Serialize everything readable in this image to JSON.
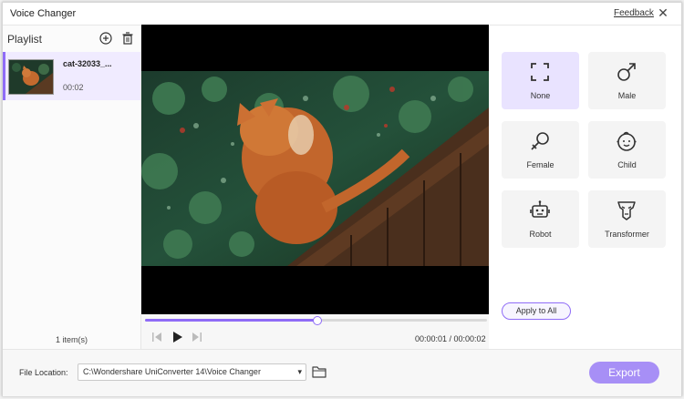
{
  "window": {
    "title": "Voice Changer",
    "feedback_label": "Feedback",
    "close_icon": "close-icon"
  },
  "playlist": {
    "title": "Playlist",
    "add_icon": "add-circle-icon",
    "delete_icon": "trash-icon",
    "items": [
      {
        "name": "cat-32033_...",
        "duration": "00:02",
        "selected": true
      }
    ],
    "count_text": "1 item(s)"
  },
  "player": {
    "progress": 0.5,
    "current_time": "00:00:01",
    "total_time": "00:00:02",
    "time_display": "00:00:01 / 00:00:02",
    "controls": [
      "previous-icon",
      "play-icon",
      "next-icon"
    ]
  },
  "effects": {
    "items": [
      {
        "label": "None",
        "icon": "none-frame-icon",
        "selected": true
      },
      {
        "label": "Male",
        "icon": "male-icon",
        "selected": false
      },
      {
        "label": "Female",
        "icon": "female-icon",
        "selected": false
      },
      {
        "label": "Child",
        "icon": "child-icon",
        "selected": false
      },
      {
        "label": "Robot",
        "icon": "robot-icon",
        "selected": false
      },
      {
        "label": "Transformer",
        "icon": "transformer-icon",
        "selected": false
      }
    ],
    "apply_all_label": "Apply to All"
  },
  "footer": {
    "file_location_label": "File Location:",
    "file_location_value": "C:\\Wondershare UniConverter 14\\Voice Changer",
    "export_label": "Export"
  },
  "colors": {
    "accent": "#8f6cf7",
    "export_bg": "#a78ff6",
    "selected_bg": "#e9e3ff"
  }
}
